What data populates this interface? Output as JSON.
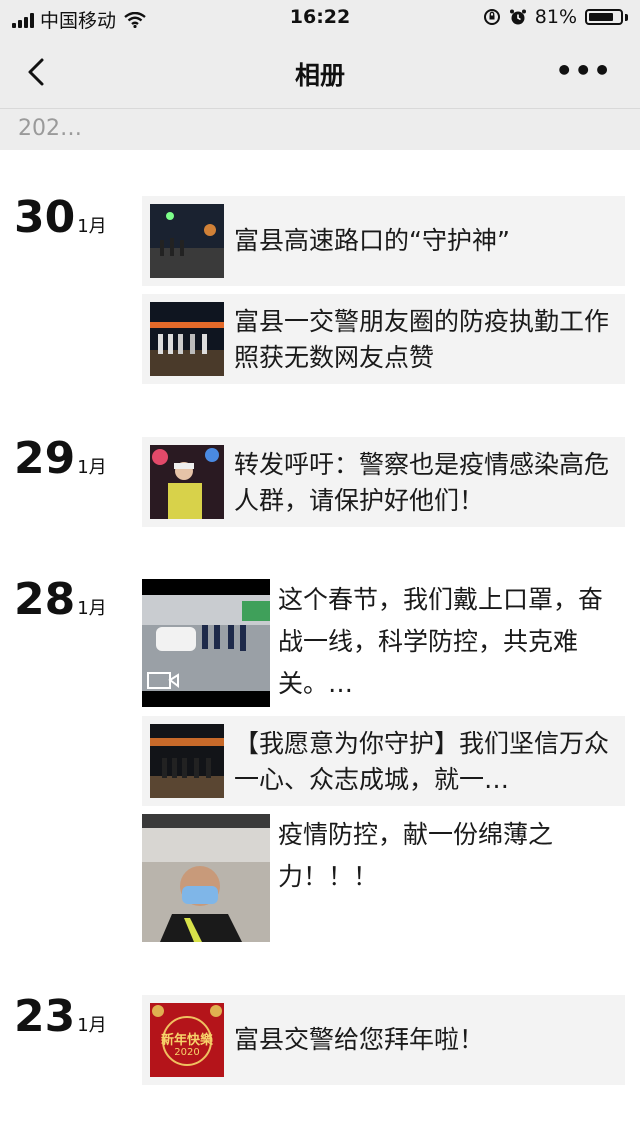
{
  "status_bar": {
    "carrier": "中国移动",
    "time": "16:22",
    "battery": "81%",
    "battery_level": 0.81
  },
  "nav": {
    "title": "相册",
    "more": "•••"
  },
  "year_hint": "202…",
  "groups": [
    {
      "day": "30",
      "month": "1月",
      "posts": [
        {
          "text": "富县高速路口的“守护神”"
        },
        {
          "text": "富县一交警朋友圈的防疫执勤工作照获无数网友点赞"
        }
      ]
    },
    {
      "day": "29",
      "month": "1月",
      "posts": [
        {
          "text": "转发呼吁：警察也是疫情感染高危人群，请保护好他们！"
        }
      ]
    },
    {
      "day": "28",
      "month": "1月",
      "posts": [
        {
          "text": "这个春节，我们戴上口罩，奋战一线，科学防控，共克难关。…"
        },
        {
          "text": "【我愿意为你守护】我们坚信万众一心、众志成城，就一…"
        },
        {
          "text": "疫情防控，献一份绵薄之力！！！"
        }
      ]
    },
    {
      "day": "23",
      "month": "1月",
      "posts": [
        {
          "text": "富县交警给您拜年啦！",
          "thumb_caption": "新年快樂",
          "thumb_year": "2020"
        }
      ]
    }
  ]
}
